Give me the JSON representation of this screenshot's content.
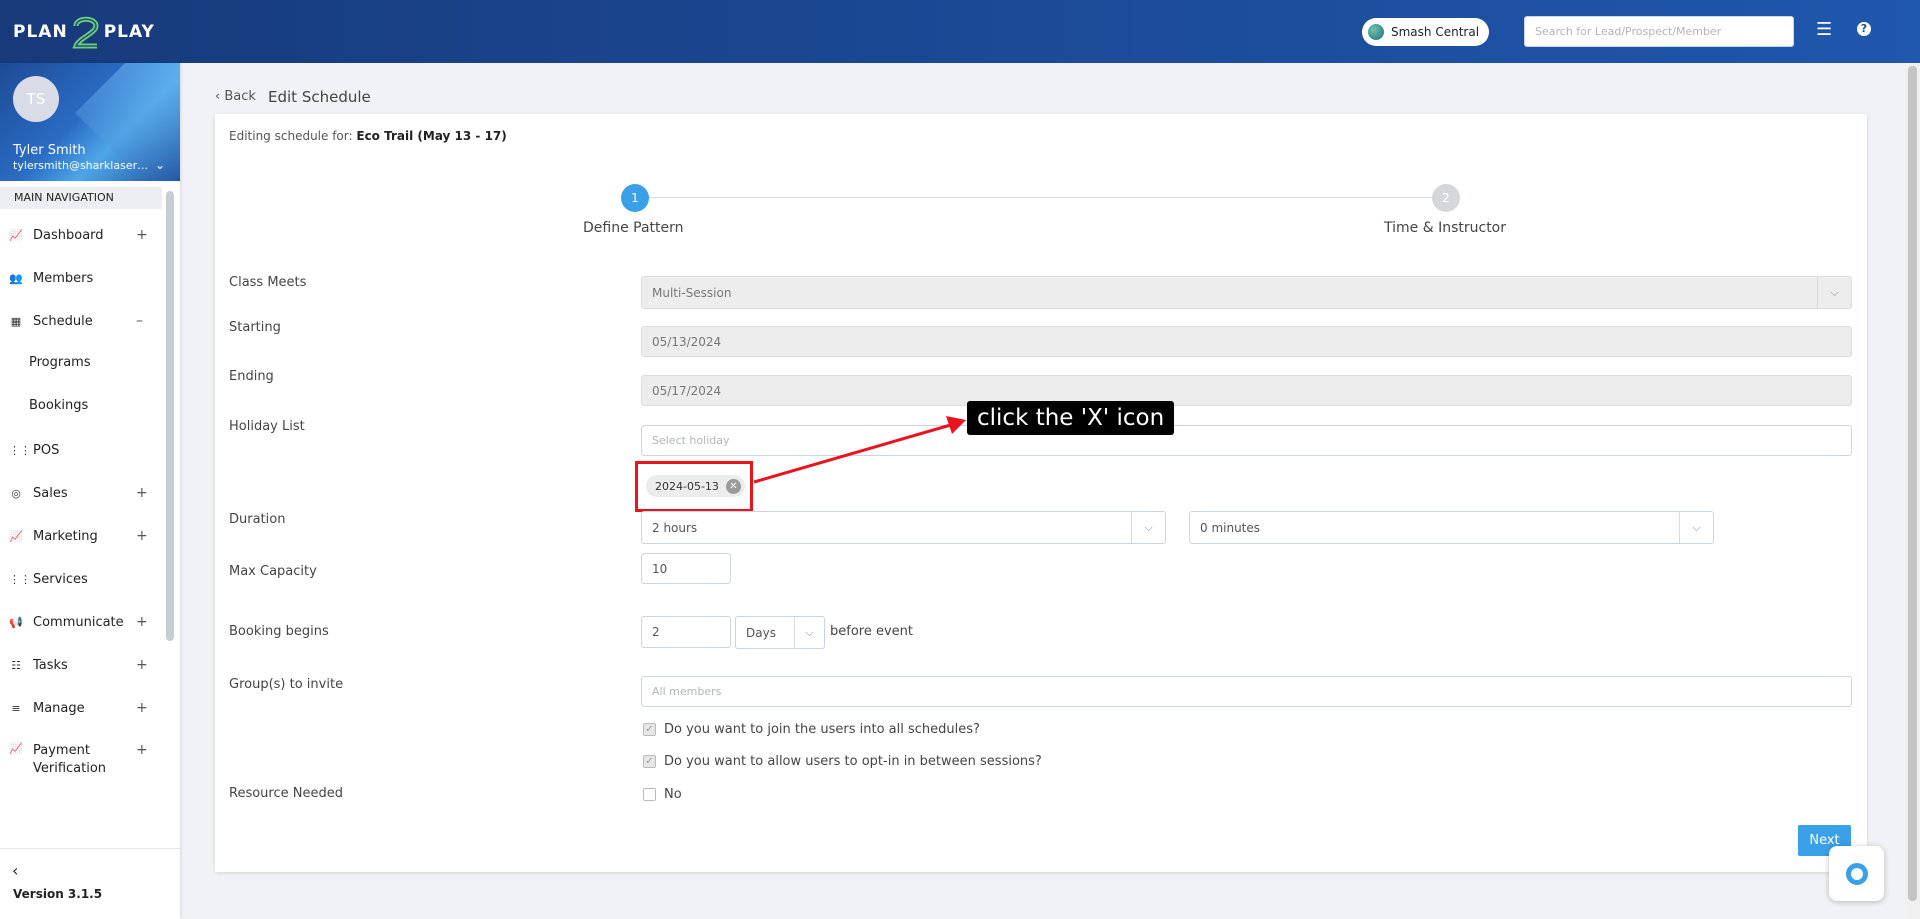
{
  "brand": {
    "logo_left": "PLAN",
    "logo_mid": "2",
    "logo_right": "PLAY"
  },
  "header": {
    "location": "Smash Central",
    "search_placeholder": "Search for Lead/Prospect/Member"
  },
  "user": {
    "initials": "TS",
    "name": "Tyler Smith",
    "email": "tylersmith@sharklasers.com"
  },
  "nav": {
    "header": "MAIN NAVIGATION",
    "items": [
      {
        "label": "Dashboard",
        "toggle": "+"
      },
      {
        "label": "Members",
        "toggle": ""
      },
      {
        "label": "Schedule",
        "toggle": "–"
      },
      {
        "label": "POS",
        "toggle": ""
      },
      {
        "label": "Sales",
        "toggle": "+"
      },
      {
        "label": "Marketing",
        "toggle": "+"
      },
      {
        "label": "Services",
        "toggle": ""
      },
      {
        "label": "Communicate",
        "toggle": "+"
      },
      {
        "label": "Tasks",
        "toggle": "+"
      },
      {
        "label": "Manage",
        "toggle": "+"
      },
      {
        "label": "Payment Verification",
        "toggle": "+"
      }
    ],
    "sub_items": [
      "Programs",
      "Bookings"
    ]
  },
  "footer": {
    "version": "Version 3.1.5"
  },
  "page": {
    "back": "Back",
    "title": "Edit Schedule",
    "editing_prefix": "Editing schedule for:",
    "editing_name": "Eco Trail (May 13 - 17)"
  },
  "steps": [
    {
      "num": "1",
      "label": "Define Pattern"
    },
    {
      "num": "2",
      "label": "Time & Instructor"
    }
  ],
  "form": {
    "class_meets": {
      "label": "Class Meets",
      "value": "Multi-Session"
    },
    "starting": {
      "label": "Starting",
      "value": "05/13/2024"
    },
    "ending": {
      "label": "Ending",
      "value": "05/17/2024"
    },
    "holiday": {
      "label": "Holiday List",
      "placeholder": "Select holiday",
      "chip": "2024-05-13"
    },
    "duration": {
      "label": "Duration",
      "hours": "2 hours",
      "minutes": "0 minutes"
    },
    "max_capacity": {
      "label": "Max Capacity",
      "value": "10"
    },
    "booking_begins": {
      "label": "Booking begins",
      "value": "2",
      "unit": "Days",
      "suffix": "before event"
    },
    "groups": {
      "label": "Group(s) to invite",
      "placeholder": "All members"
    },
    "join_all": "Do you want to join the users into all schedules?",
    "opt_in": "Do you want to allow users to opt-in in between sessions?",
    "resource": {
      "label": "Resource Needed",
      "option": "No"
    }
  },
  "annotation": "click the 'X' icon",
  "buttons": {
    "next": "Next"
  }
}
